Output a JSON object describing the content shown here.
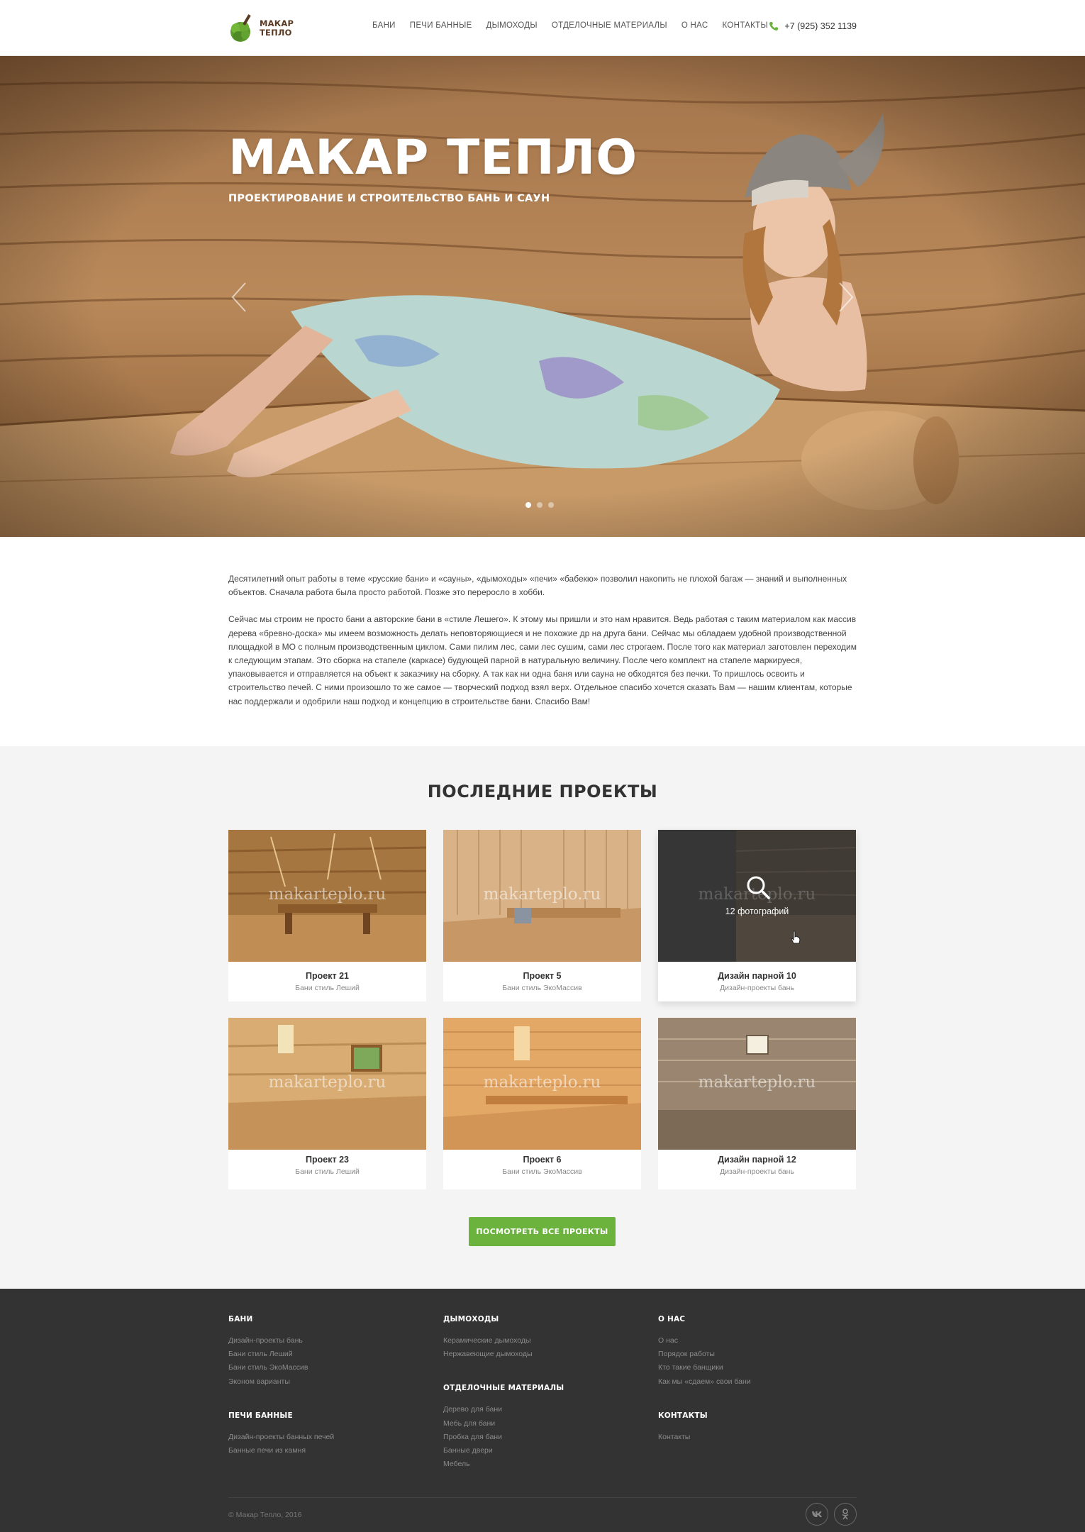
{
  "header": {
    "logo_line1": "МАКАР",
    "logo_line2": "ТЕПЛО",
    "nav": [
      "БАНИ",
      "ПЕЧИ БАННЫЕ",
      "ДЫМОХОДЫ",
      "ОТДЕЛОЧНЫЕ МАТЕРИАЛЫ",
      "О НАС",
      "КОНТАКТЫ"
    ],
    "phone": "+7 (925) 352 1139"
  },
  "hero": {
    "title": "МАКАР ТЕПЛО",
    "subtitle": "ПРОЕКТИРОВАНИЕ И СТРОИТЕЛЬСТВО БАНЬ И САУН",
    "slides_count": 3,
    "active_slide": 1
  },
  "intro": {
    "p1": "Десятилетний опыт работы в теме «русские бани» и «сауны», «дымоходы» «печи» «бабекю» позволил накопить не плохой багаж — знаний и выполненных объектов. Сначала работа была просто работой. Позже это переросло в хобби.",
    "p2": "Сейчас мы строим не просто бани а авторские бани в «стиле Лешего». К этому мы пришли и это нам нравится. Ведь работая с таким материалом как массив дерева «бревно-доска» мы имеем возможность делать неповторяющиеся и не похожие др на друга бани. Сейчас мы обладаем удобной производственной площадкой в МО с полным производственным циклом. Сами пилим лес, сами лес сушим, сами лес строгаем. После того как материал заготовлен переходим к следующим этапам. Это сборка на стапеле (каркасе) будующей парной в натуральную величину. После чего комплект на стапеле маркируеся, упаковывается и отправляется на объект к заказчику на сборку. А так как ни одна баня или сауна не обходятся без печки. То пришлось освоить и строительство печей. С ними произошло то же самое — творческий подход взял верх. Отдельное спасибо хочется сказать Вам — нашим клиентам, которые нас поддержали и одобрили наш подход и концепцию в строительстве бани. Спасибо Вам!"
  },
  "projects": {
    "title": "ПОСЛЕДНИЕ ПРОЕКТЫ",
    "watermark": "makarteplo.ru",
    "items": [
      {
        "name": "Проект 21",
        "category": "Бани стиль Леший"
      },
      {
        "name": "Проект 5",
        "category": "Бани стиль ЭкоМассив"
      },
      {
        "name": "Дизайн парной 10",
        "category": "Дизайн-проекты бань",
        "overlay": "12 фотографий"
      },
      {
        "name": "Проект 23",
        "category": "Бани стиль Леший"
      },
      {
        "name": "Проект 6",
        "category": "Бани стиль ЭкоМассив"
      },
      {
        "name": "Дизайн парной 12",
        "category": "Дизайн-проекты бань"
      }
    ],
    "button": "ПОСМОТРЕТЬ ВСЕ ПРОЕКТЫ"
  },
  "footer": {
    "col1": {
      "h1": "БАНИ",
      "links1": [
        "Дизайн-проекты бань",
        "Бани стиль Леший",
        "Бани стиль ЭкоМассив",
        "Эконом варианты"
      ],
      "h2": "ПЕЧИ БАННЫЕ",
      "links2": [
        "Дизайн-проекты банных печей",
        "Банные печи из камня"
      ]
    },
    "col2": {
      "h1": "ДЫМОХОДЫ",
      "links1": [
        "Керамические дымоходы",
        "Нержавеющие дымоходы"
      ],
      "h2": "ОТДЕЛОЧНЫЕ МАТЕРИАЛЫ",
      "links2": [
        "Дерево для бани",
        "Мебь для бани",
        "Пробка для бани",
        "Банные двери",
        "Мебель"
      ]
    },
    "col3": {
      "h1": "О НАС",
      "links1": [
        "О нас",
        "Порядок работы",
        "Кто такие банщики",
        "Как мы «сдаем» свои бани"
      ],
      "h2": "КОНТАКТЫ",
      "links2": [
        "Контакты"
      ]
    },
    "copyright": "© Макар Тепло, 2016",
    "social": [
      "vk-icon",
      "odnoklassniki-icon"
    ]
  },
  "colors": {
    "accent": "#6cb33e",
    "footer_bg": "#333333",
    "projects_bg": "#f4f4f4"
  }
}
